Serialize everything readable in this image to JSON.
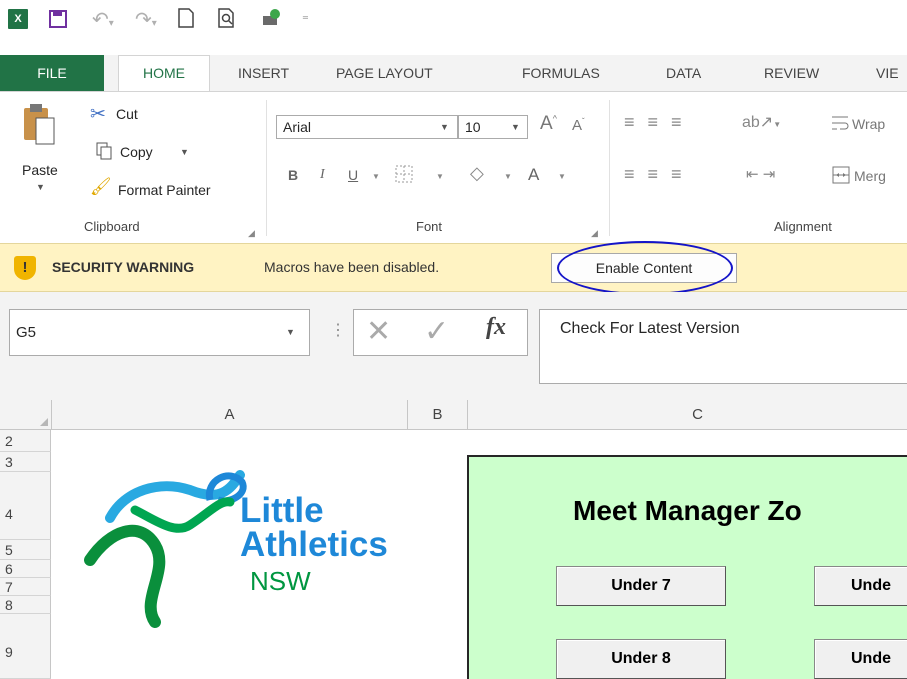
{
  "qat": {
    "icons": [
      "excel-icon",
      "save-icon",
      "undo-icon",
      "redo-icon",
      "new-icon",
      "print-preview-icon",
      "share-icon",
      "customize-icon"
    ]
  },
  "tabs": [
    "FILE",
    "HOME",
    "INSERT",
    "PAGE LAYOUT",
    "FORMULAS",
    "DATA",
    "REVIEW",
    "VIE"
  ],
  "ribbon": {
    "clipboard": {
      "paste": "Paste",
      "cut": "Cut",
      "copy": "Copy",
      "format_painter": "Format Painter",
      "label": "Clipboard"
    },
    "font": {
      "name": "Arial",
      "size": "10",
      "label": "Font",
      "bold": "B",
      "italic": "I",
      "underline": "U",
      "font_color": "A"
    },
    "alignment": {
      "wrap": "Wrap",
      "merge": "Merg",
      "label": "Alignment"
    }
  },
  "security": {
    "title": "SECURITY WARNING",
    "message": "Macros have been disabled.",
    "button": "Enable Content"
  },
  "formula_bar": {
    "name_box": "G5",
    "formula": "Check For Latest Version"
  },
  "columns": [
    "A",
    "B",
    "C"
  ],
  "rows": [
    "2",
    "3",
    "4",
    "5",
    "6",
    "7",
    "8",
    "9"
  ],
  "sheet": {
    "logo": {
      "line1": "Little",
      "line2": "Athletics",
      "line3": "NSW"
    },
    "panel_title": "Meet Manager Zo",
    "buttons": [
      "Under 7",
      "Unde",
      "Under 8",
      "Unde"
    ]
  },
  "colors": {
    "excel_green": "#217346",
    "warning_bg": "#fff3c3",
    "panel_bg": "#ccffcc",
    "annotation": "#1414c8"
  }
}
